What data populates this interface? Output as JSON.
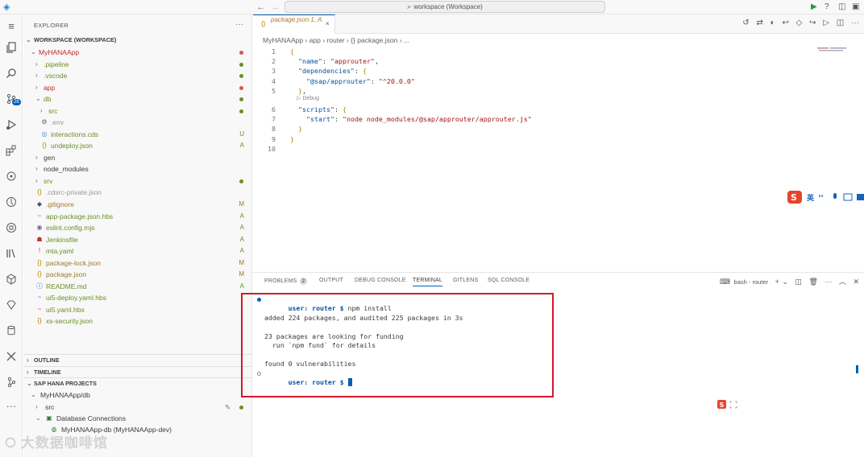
{
  "titlebar": {
    "search_text": "workspace (Workspace)"
  },
  "activity": {
    "source_control_badge": "26"
  },
  "sidebar": {
    "title": "EXPLORER",
    "workspace_label": "WORKSPACE (WORKSPACE)",
    "tree": [
      {
        "label": "MyHANAApp",
        "status": "",
        "color": "#c1272d"
      },
      {
        "label": ".pipeline",
        "status": "",
        "color": "#6b8e23"
      },
      {
        "label": ".vscode",
        "status": "",
        "color": "#6b8e23"
      },
      {
        "label": "app",
        "status": "",
        "color": "#c1272d"
      },
      {
        "label": "db",
        "status": "",
        "color": "#6b8e23"
      },
      {
        "label": "src",
        "status": "",
        "color": "#6b8e23"
      },
      {
        "label": ".env",
        "status": "",
        "color": "#999999"
      },
      {
        "label": "interactions.cds",
        "status": "U",
        "color": "#6b8e23"
      },
      {
        "label": "undeploy.json",
        "status": "A",
        "color": "#6b8e23"
      },
      {
        "label": "gen",
        "status": "",
        "color": "#3b3b3b"
      },
      {
        "label": "node_modules",
        "status": "",
        "color": "#3b3b3b"
      },
      {
        "label": "srv",
        "status": "",
        "color": "#6b8e23"
      },
      {
        "label": ".cdsrc-private.json",
        "status": "",
        "color": "#999999"
      },
      {
        "label": ".gitignore",
        "status": "M",
        "color": "#a0782a"
      },
      {
        "label": "app-package.json.hbs",
        "status": "A",
        "color": "#6b8e23"
      },
      {
        "label": "eslint.config.mjs",
        "status": "A",
        "color": "#6b8e23"
      },
      {
        "label": "Jenkinsfile",
        "status": "A",
        "color": "#6b8e23"
      },
      {
        "label": "mta.yaml",
        "status": "A",
        "color": "#6b8e23"
      },
      {
        "label": "package-lock.json",
        "status": "M",
        "color": "#a0782a"
      },
      {
        "label": "package.json",
        "status": "M",
        "color": "#a0782a"
      },
      {
        "label": "README.md",
        "status": "A",
        "color": "#6b8e23"
      },
      {
        "label": "ui5-deploy.yaml.hbs",
        "status": "",
        "color": "#6b8e23"
      },
      {
        "label": "ui5.yaml.hbs",
        "status": "",
        "color": "#6b8e23"
      },
      {
        "label": "xs-security.json",
        "status": "",
        "color": "#6b8e23"
      }
    ],
    "outline": "OUTLINE",
    "timeline": "TIMELINE",
    "hana_projects": "SAP HANA PROJECTS",
    "hana_tree": [
      {
        "label": "MyHANAApp/db"
      },
      {
        "label": "src"
      },
      {
        "label": "Database Connections"
      },
      {
        "label": "MyHANAApp-db (MyHANAApp-dev)"
      }
    ]
  },
  "editor": {
    "tab_label": "package.json 1, A",
    "breadcrumb": [
      "MyHANAApp",
      "app",
      "router",
      "{} package.json",
      "..."
    ],
    "codelens": "Debug",
    "lines": [
      {
        "n": "1",
        "t": "{"
      },
      {
        "n": "2",
        "t": "  \"name\": \"approuter\","
      },
      {
        "n": "3",
        "t": "  \"dependencies\": {"
      },
      {
        "n": "4",
        "t": "    \"@sap/approuter\": \"^20.0.0\""
      },
      {
        "n": "5",
        "t": "  },"
      },
      {
        "n": "6",
        "t": "  \"scripts\": {"
      },
      {
        "n": "7",
        "t": "    \"start\": \"node node_modules/@sap/approuter/approuter.js\""
      },
      {
        "n": "8",
        "t": "  }"
      },
      {
        "n": "9",
        "t": "}"
      },
      {
        "n": "10",
        "t": ""
      }
    ]
  },
  "panel": {
    "tabs": [
      "PROBLEMS",
      "OUTPUT",
      "DEBUG CONSOLE",
      "TERMINAL",
      "GITLENS",
      "SQL CONSOLE"
    ],
    "problems_count": "2",
    "active_tab": "TERMINAL",
    "terminal_name": "bash - router",
    "terminal": {
      "prompt": "user: router $",
      "command": "npm install",
      "out1": "added 224 packages, and audited 225 packages in 3s",
      "out2": "23 packages are looking for funding",
      "out3": "  run `npm fund` for details",
      "out4": "found 0 vulnerabilities"
    }
  },
  "ime": {
    "label": "英"
  },
  "watermark": "大数据咖啡馆",
  "colors": {
    "accent": "#005fb8",
    "highlight_box": "#d11a2a"
  }
}
